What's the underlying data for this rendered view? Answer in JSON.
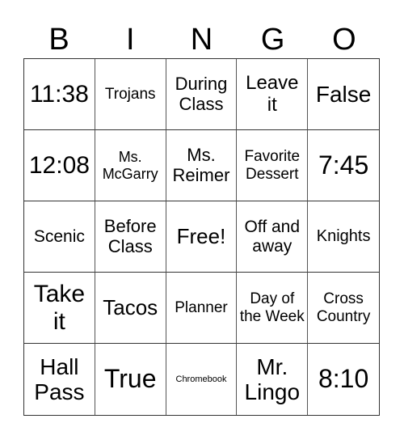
{
  "header": [
    "B",
    "I",
    "N",
    "G",
    "O"
  ],
  "cells": [
    [
      "11:38",
      "Trojans",
      "During Class",
      "Leave it",
      "False"
    ],
    [
      "12:08",
      "Ms. McGarry",
      "Ms. Reimer",
      "Favorite Dessert",
      "7:45"
    ],
    [
      "Scenic",
      "Before Class",
      "Free!",
      "Off and away",
      "Knights"
    ],
    [
      "Take it",
      "Tacos",
      "Planner",
      "Day of the Week",
      "Cross Country"
    ],
    [
      "Hall Pass",
      "True",
      "Chromebook",
      "Mr. Lingo",
      "8:10"
    ]
  ]
}
